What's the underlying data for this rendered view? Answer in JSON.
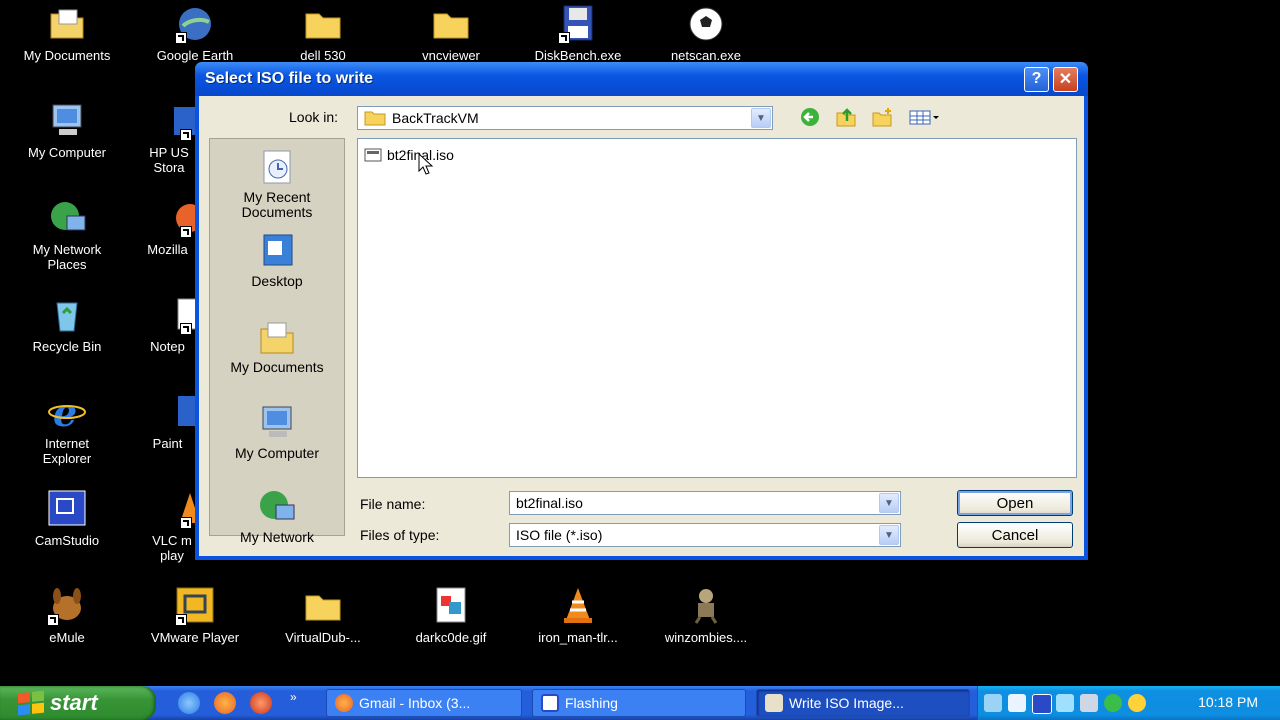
{
  "desktop": {
    "icons": [
      {
        "label": "My Documents"
      },
      {
        "label": "Google Earth"
      },
      {
        "label": "dell 530"
      },
      {
        "label": "vncviewer"
      },
      {
        "label": "DiskBench.exe"
      },
      {
        "label": "netscan.exe"
      },
      {
        "label": "My Computer"
      },
      {
        "label": "HP US Stora"
      },
      {
        "label": "My Network Places"
      },
      {
        "label": "Mozilla"
      },
      {
        "label": "Recycle Bin"
      },
      {
        "label": "Notep"
      },
      {
        "label": "Internet Explorer"
      },
      {
        "label": "Paint"
      },
      {
        "label": "CamStudio"
      },
      {
        "label": "VLC m play"
      },
      {
        "label": "eMule"
      },
      {
        "label": "VMware Player"
      },
      {
        "label": "VirtualDub-..."
      },
      {
        "label": "darkc0de.gif"
      },
      {
        "label": "iron_man-tlr..."
      },
      {
        "label": "winzombies...."
      }
    ]
  },
  "dialog": {
    "title": "Select ISO file to write",
    "help_label": "?",
    "close_label": "✕",
    "look_in_label": "Look in:",
    "look_in_value": "BackTrackVM",
    "places": [
      {
        "label": "My Recent Documents"
      },
      {
        "label": "Desktop"
      },
      {
        "label": "My Documents"
      },
      {
        "label": "My Computer"
      },
      {
        "label": "My Network"
      }
    ],
    "files": [
      {
        "name": "bt2final.iso"
      }
    ],
    "file_name_label": "File name:",
    "file_name_value": "bt2final.iso",
    "files_of_type_label": "Files of type:",
    "files_of_type_value": "ISO file (*.iso)",
    "open_label": "Open",
    "cancel_label": "Cancel"
  },
  "taskbar": {
    "start_label": "start",
    "tasks": [
      {
        "label": "Gmail - Inbox (3..."
      },
      {
        "label": "Flashing"
      },
      {
        "label": "Write ISO Image..."
      }
    ],
    "clock": "10:18 PM"
  }
}
